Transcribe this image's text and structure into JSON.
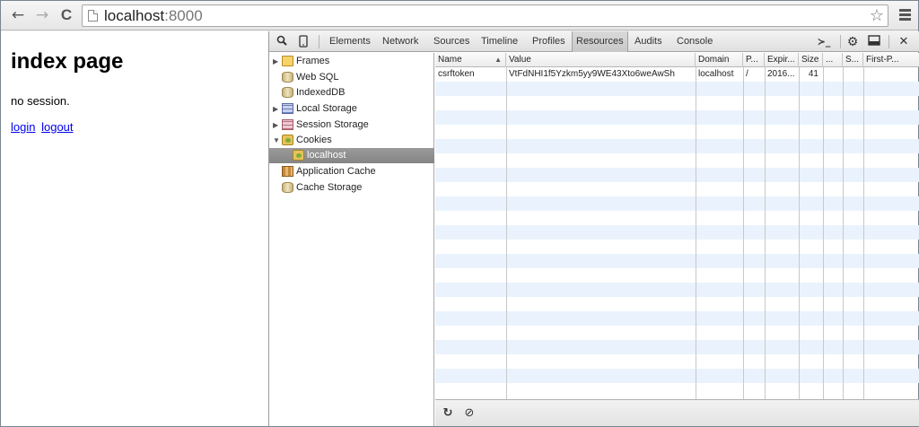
{
  "browser": {
    "back_icon": "←",
    "forward_icon": "→",
    "reload_icon": "C",
    "url_host": "localhost",
    "url_port": ":8000",
    "star_icon": "☆"
  },
  "page": {
    "title": "index page",
    "session_text": "no session.",
    "links": [
      "login",
      "logout"
    ]
  },
  "devtools": {
    "tabs": [
      "Elements",
      "Network",
      "Sources",
      "Timeline",
      "Profiles",
      "Resources",
      "Audits",
      "Console"
    ],
    "active_tab": "Resources",
    "console_icon": "≻_",
    "settings_icon": "⚙",
    "dock_icon": "▭",
    "close_icon": "✕",
    "search_icon": "🔍",
    "device_icon": "▯",
    "sidebar": [
      {
        "label": "Frames",
        "icon": "folder-icon",
        "arrow": "▶"
      },
      {
        "label": "Web SQL",
        "icon": "database-icon",
        "arrow": ""
      },
      {
        "label": "IndexedDB",
        "icon": "database-icon",
        "arrow": ""
      },
      {
        "label": "Local Storage",
        "icon": "storage-grid-icon",
        "arrow": "▶"
      },
      {
        "label": "Session Storage",
        "icon": "storage-grid-icon",
        "arrow": "▶"
      },
      {
        "label": "Cookies",
        "icon": "cookie-icon",
        "arrow": "▼"
      },
      {
        "label": "localhost",
        "icon": "cookie-icon",
        "arrow": "",
        "selected": true
      },
      {
        "label": "Application Cache",
        "icon": "app-cache-icon",
        "arrow": ""
      },
      {
        "label": "Cache Storage",
        "icon": "database-icon",
        "arrow": ""
      }
    ],
    "columns": [
      "Name",
      "Value",
      "Domain",
      "P...",
      "Expir...",
      "Size",
      "...",
      "S...",
      "First-P..."
    ],
    "rows": [
      [
        "csrftoken",
        "VtFdNHI1f5Yzkm5yy9WE43Xto6weAwSh",
        "localhost",
        "/",
        "2016...",
        "41",
        "",
        "",
        ""
      ]
    ],
    "refresh_icon": "↻",
    "clear_icon": "⊘"
  }
}
